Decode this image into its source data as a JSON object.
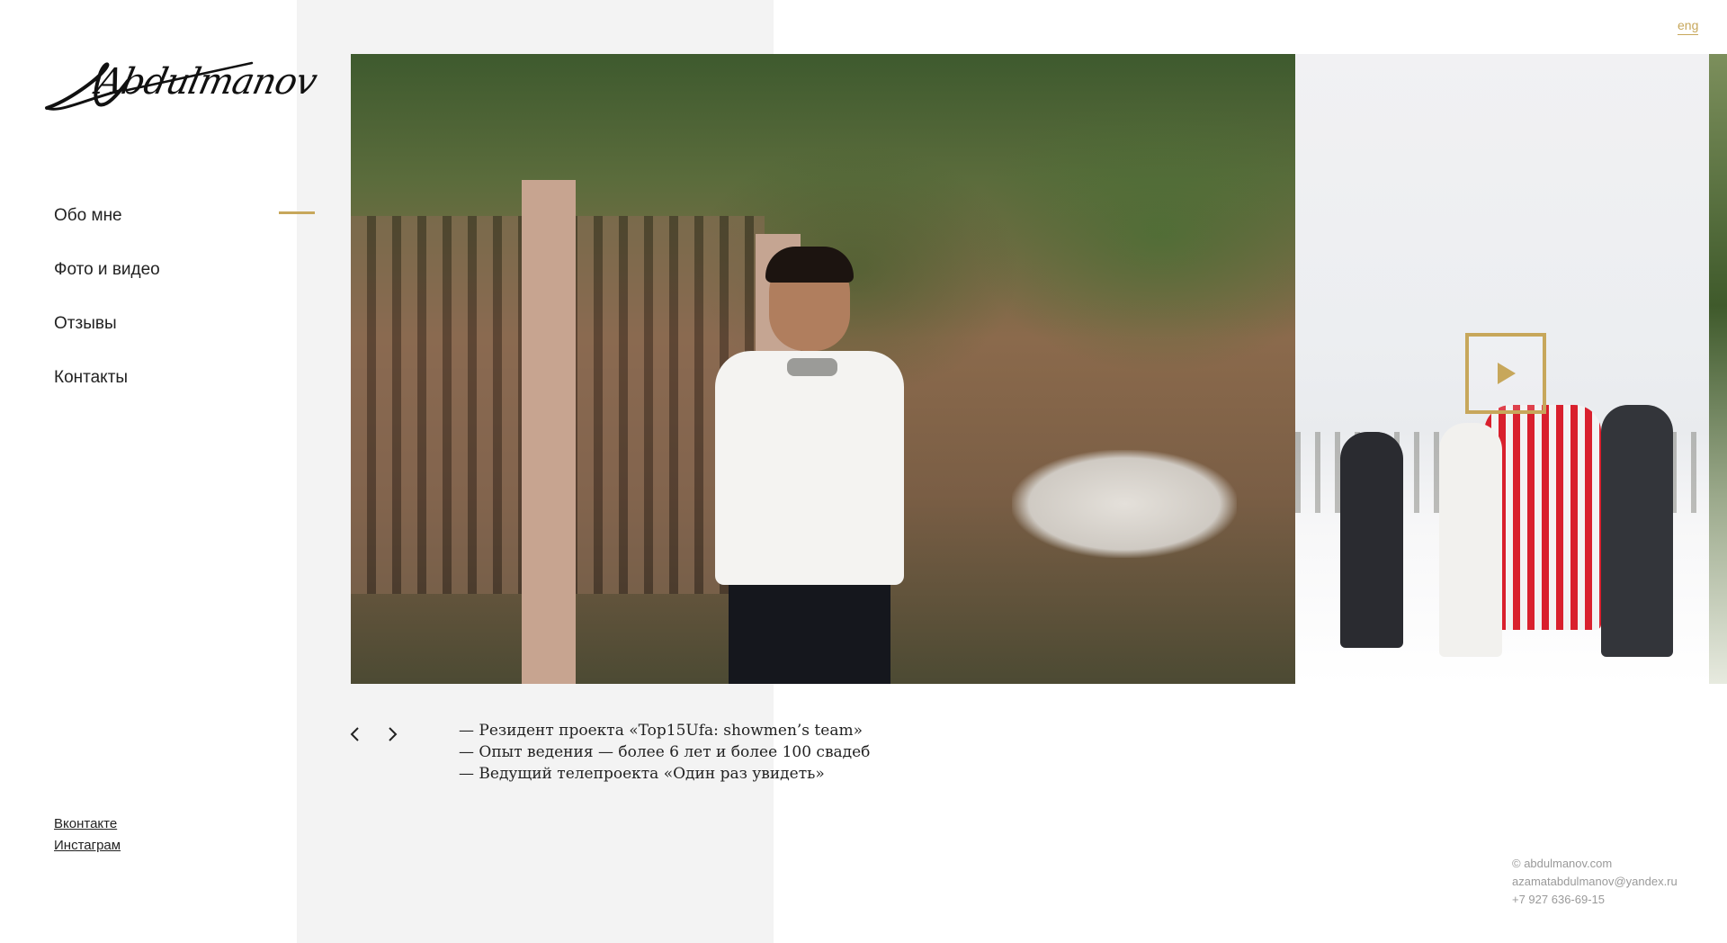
{
  "header": {
    "logo_text": "Abdulmanov",
    "lang_label": "eng"
  },
  "nav": {
    "items": [
      {
        "label": "Обо мне",
        "active": true
      },
      {
        "label": "Фото и видео"
      },
      {
        "label": "Отзывы"
      },
      {
        "label": "Контакты"
      }
    ]
  },
  "social": {
    "vk_label": "Вконтакте",
    "instagram_label": "Инстаграм"
  },
  "slider": {
    "caption": [
      "— Резидент проекта «Top15Ufa: showmen’s team»",
      "— Опыт ведения — более 6 лет и более 100 свадеб",
      "— Ведущий телепроекта «Один раз увидеть»"
    ]
  },
  "footer": {
    "copyright": "© abdulmanov.com",
    "email": "azamatabdulmanov@yandex.ru",
    "phone": "+7 927 636-69-15"
  },
  "colors": {
    "accent": "#c7a75b",
    "grey_band": "#f3f3f3",
    "text": "#222222",
    "footer_text": "#9a9a9a"
  },
  "icons": {
    "prev": "chevron-left-icon",
    "next": "chevron-right-icon",
    "play": "play-icon"
  }
}
